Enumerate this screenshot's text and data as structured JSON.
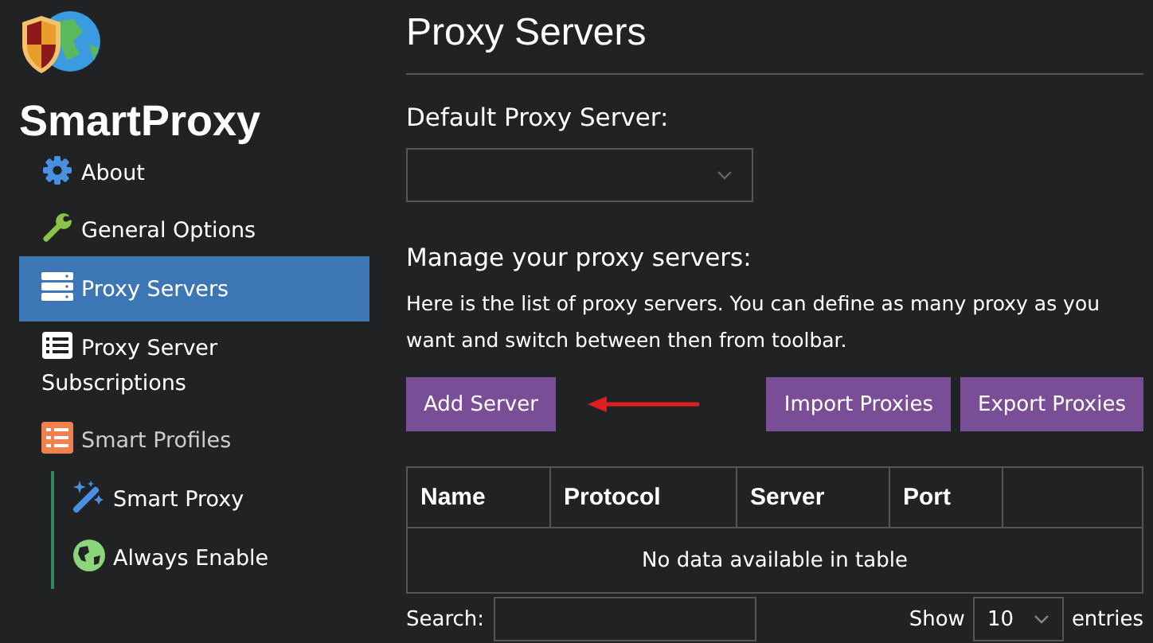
{
  "sidebar": {
    "app_name": "SmartProxy",
    "items": [
      {
        "label": "About",
        "selected": false
      },
      {
        "label": "General Options",
        "selected": false
      },
      {
        "label": "Proxy Servers",
        "selected": true
      },
      {
        "label": "Proxy Server Subscriptions",
        "selected": false
      },
      {
        "label": "Smart Profiles",
        "selected": false,
        "children": [
          {
            "label": "Smart Proxy",
            "selected": false
          },
          {
            "label": "Always Enable",
            "selected": false
          }
        ]
      }
    ]
  },
  "page": {
    "title": "Proxy Servers",
    "default_label": "Default Proxy Server:",
    "manage_heading": "Manage your proxy servers:",
    "description": "Here is the list of proxy servers. You can define as many proxy as you want and switch between then from toolbar.",
    "buttons": [
      "Add Server",
      "Import Proxies",
      "Export Proxies"
    ],
    "table": {
      "columns": [
        "Name",
        "Protocol",
        "Server",
        "Port",
        ""
      ],
      "empty_message": "No data available in table"
    },
    "search_label": "Search:",
    "show_label": "Show",
    "page_size": "10",
    "entries_label": "entries"
  }
}
